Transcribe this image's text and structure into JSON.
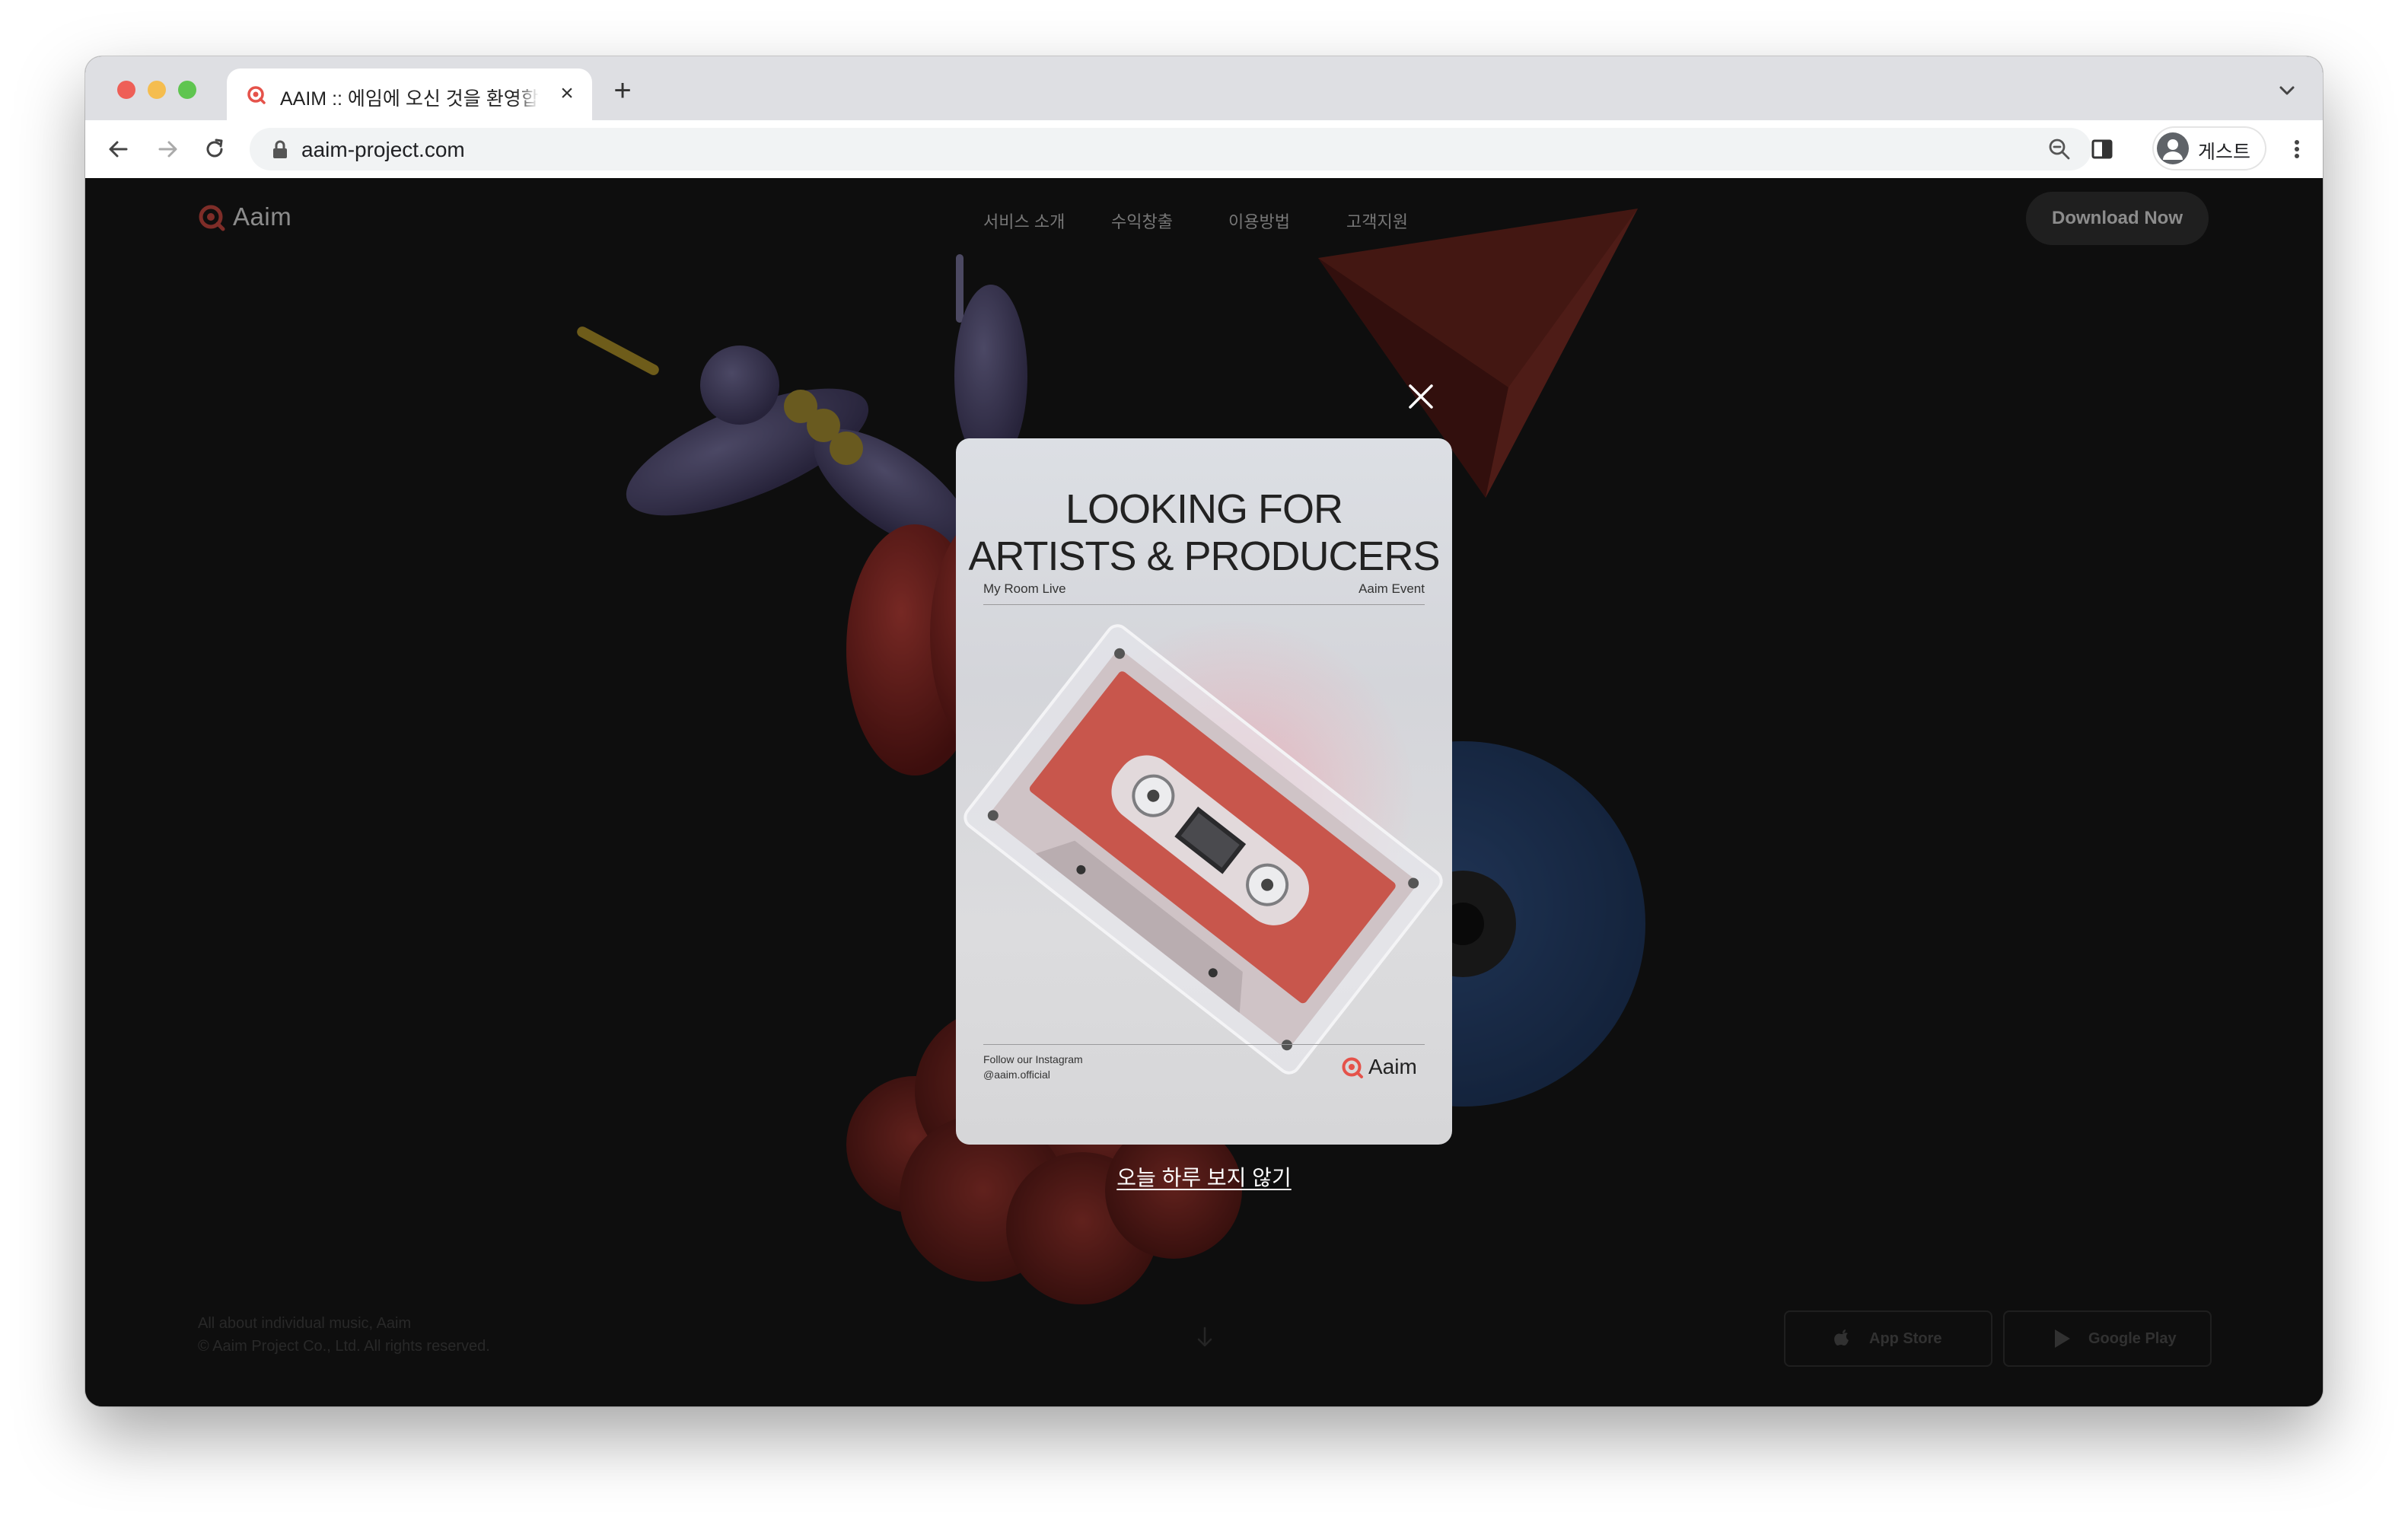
{
  "browser": {
    "tab": {
      "title": "AAIM :: 에임에 오신 것을 환영합니다",
      "close_glyph": "×"
    },
    "new_tab_glyph": "+",
    "address": {
      "url": "aaim-project.com"
    },
    "profile": {
      "label": "게스트"
    }
  },
  "site": {
    "logo_text": "Aaim",
    "nav": [
      "서비스 소개",
      "수익창출",
      "이용방법",
      "고객지원"
    ],
    "download_label": "Download Now",
    "footer": {
      "tagline": "All about individual music, Aaim",
      "copyright": "© Aaim Project Co., Ltd. All rights reserved."
    },
    "stores": [
      "App Store",
      "Google Play"
    ]
  },
  "popup": {
    "title_line1": "LOOKING FOR",
    "title_line2": "ARTISTS & PRODUCERS",
    "left_sub": "My Room Live",
    "right_sub": "Aaim Event",
    "follow_line1": "Follow our Instagram",
    "follow_line2": "@aaim.official",
    "logo_text": "Aaim",
    "dismiss_label": "오늘 하루 보지 않기"
  },
  "colors": {
    "brand": "#e5524a",
    "site_bg": "#1b1b1b",
    "cassette_red": "#c8564c"
  }
}
